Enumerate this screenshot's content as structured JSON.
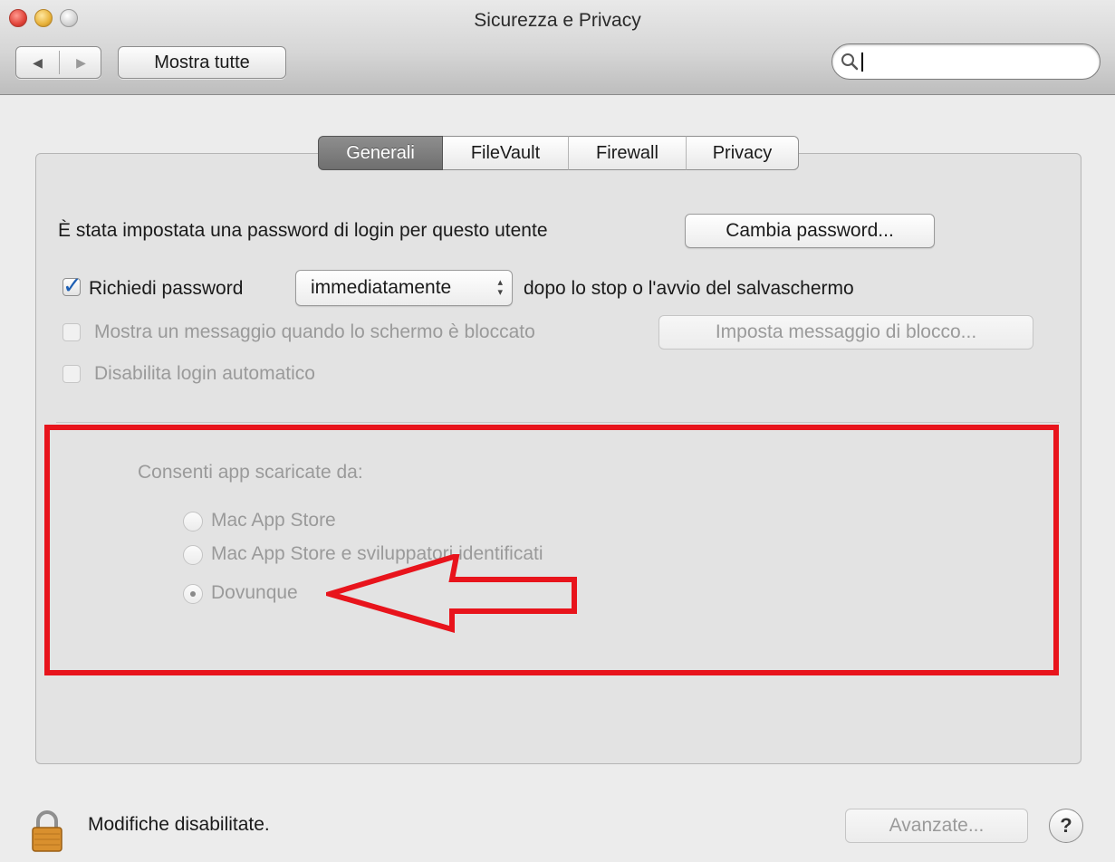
{
  "window": {
    "title": "Sicurezza e Privacy"
  },
  "toolbar": {
    "back_glyph": "◀",
    "forward_glyph": "▶",
    "show_all_label": "Mostra tutte",
    "search_value": "",
    "search_icon": "search-icon"
  },
  "tabs": [
    {
      "label": "Generali",
      "selected": true
    },
    {
      "label": "FileVault",
      "selected": false
    },
    {
      "label": "Firewall",
      "selected": false
    },
    {
      "label": "Privacy",
      "selected": false
    }
  ],
  "general": {
    "password_set_text": "È stata impostata una password di login per questo utente",
    "change_password_label": "Cambia password...",
    "require_password": {
      "checked": true,
      "label": "Richiedi password",
      "delay_value": "immediatamente",
      "suffix": "dopo lo stop o l'avvio del salvaschermo"
    },
    "show_message": {
      "checked": false,
      "enabled": false,
      "label": "Mostra un messaggio quando lo schermo è bloccato",
      "button_label": "Imposta messaggio di blocco..."
    },
    "disable_autologin": {
      "checked": false,
      "enabled": false,
      "label": "Disabilita login automatico"
    }
  },
  "allow_apps": {
    "heading": "Consenti app scaricate da:",
    "options": [
      {
        "label": "Mac App Store",
        "selected": false
      },
      {
        "label": "Mac App Store e sviluppatori identificati",
        "selected": false
      },
      {
        "label": "Dovunque",
        "selected": true
      }
    ]
  },
  "annotation": {
    "box_color": "#e8141c",
    "arrow_color": "#e8141c"
  },
  "footer": {
    "lock_status": "Modifiche disabilitate.",
    "advanced_label": "Avanzate...",
    "help_label": "?"
  }
}
